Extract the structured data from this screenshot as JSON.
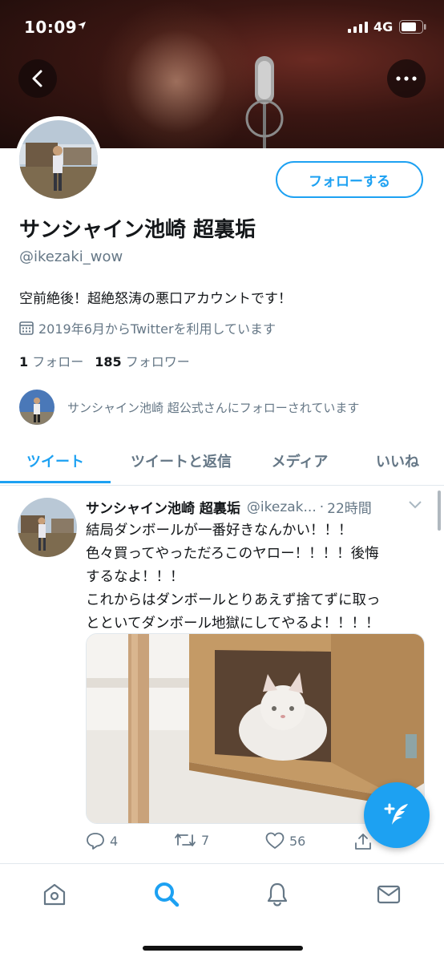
{
  "status_bar": {
    "time": "10:09",
    "network": "4G"
  },
  "profile": {
    "display_name": "サンシャイン池崎 超裏垢",
    "handle": "@ikezaki_wow",
    "follow_button": "フォローする",
    "bio": "空前絶後！超絶怒涛の悪口アカウントです！",
    "joined": "2019年6月からTwitterを利用しています",
    "following_count": "1",
    "following_label": "フォロー",
    "followers_count": "185",
    "followers_label": "フォロワー",
    "followed_by": "サンシャイン池崎 超公式さんにフォローされています"
  },
  "tabs": [
    {
      "label": "ツイート",
      "active": true
    },
    {
      "label": "ツイートと返信",
      "active": false
    },
    {
      "label": "メディア",
      "active": false
    },
    {
      "label": "いいね",
      "active": false
    }
  ],
  "tweet": {
    "name": "サンシャイン池崎 超裏垢",
    "handle": "@ikezak...",
    "time": "22時間",
    "lines": [
      "結局ダンボールが一番好きなんかい！！！",
      "色々買ってやっただろこのヤロー！！！！後悔",
      "するなよ！！！",
      "これからはダンボールとりあえず捨てずに取っ",
      "とといてダンボール地獄にしてやるよ！！！！"
    ],
    "replies": "4",
    "retweets": "7",
    "likes": "56"
  },
  "colors": {
    "accent": "#1da1f2",
    "secondary_text": "#657786"
  },
  "icons": [
    "back-arrow-icon",
    "more-dots-icon",
    "calendar-icon",
    "reply-icon",
    "retweet-icon",
    "like-icon",
    "share-icon",
    "compose-tweet-icon",
    "home-icon",
    "search-icon",
    "notifications-icon",
    "messages-icon"
  ]
}
